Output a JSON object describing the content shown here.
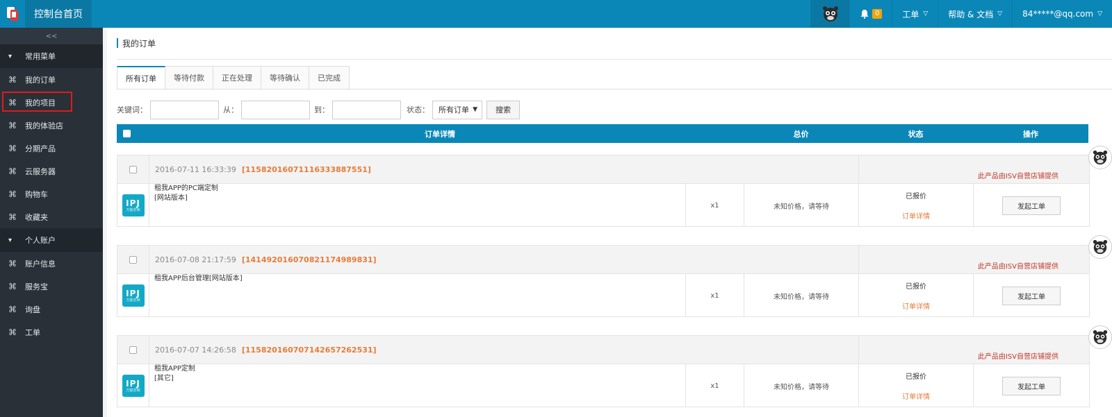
{
  "header": {
    "app_title": "控制台首页",
    "bell_count": "0",
    "menu_ticket": "工单",
    "menu_help": "帮助 & 文档",
    "user": "84*****@qq.com"
  },
  "sidebar": {
    "collapse_label": "<<",
    "group1": "常用菜单",
    "items1": [
      "我的订单",
      "我的项目",
      "我的体验店",
      "分期产品",
      "云服务器",
      "购物车",
      "收藏夹"
    ],
    "group2": "个人账户",
    "items2": [
      "账户信息",
      "服务宝",
      "询盘",
      "工单"
    ]
  },
  "main": {
    "page_title": "我的订单",
    "tabs": [
      "所有订单",
      "等待付款",
      "正在处理",
      "等待确认",
      "已完成"
    ],
    "filters": {
      "keyword_label": "关键词：",
      "from_label": "从：",
      "to_label": "到：",
      "status_label": "状态：",
      "status_value": "所有订单",
      "search_button": "搜索"
    },
    "table_headers": {
      "detail": "订单详情",
      "total": "总价",
      "status": "状态",
      "action": "操作"
    },
    "orders": [
      {
        "datetime": "2016-07-11 16:33:39",
        "order_no": "[11582016071116333887551]",
        "provider_note": "此产品由ISV自营店铺提供",
        "logo_text": "IPJ",
        "logo_sub": "万能定制",
        "name_line1": "租我APP的PC端定制",
        "name_line2": "[网站版本]",
        "qty": "x1",
        "price": "未知价格，请等待",
        "status": "已报价",
        "detail_link": "订单详情",
        "action_button": "发起工单"
      },
      {
        "datetime": "2016-07-08 21:17:59",
        "order_no": "[14149201607082117498983​1]",
        "provider_note": "此产品由ISV自营店铺提供",
        "logo_text": "IPJ",
        "logo_sub": "万能定制",
        "name_line1": "租我APP后台管理[网站版本]",
        "name_line2": "",
        "qty": "x1",
        "price": "未知价格，请等待",
        "status": "已报价",
        "detail_link": "订单详情",
        "action_button": "发起工单"
      },
      {
        "datetime": "2016-07-07 14:26:58",
        "order_no": "[11582016070714265726253​1]",
        "provider_note": "此产品由ISV自营店铺提供",
        "logo_text": "IPJ",
        "logo_sub": "万能定制",
        "name_line1": "租我APP定制",
        "name_line2": "[其它]",
        "qty": "x1",
        "price": "未知价格，请等待",
        "status": "已报价",
        "detail_link": "订单详情",
        "action_button": "发起工单"
      }
    ]
  },
  "colors": {
    "topbar": "#0a87b7",
    "sidebar": "#293038",
    "order_no": "#e67c39",
    "isv_note": "#c0392b",
    "highlight_box": "#e01b1b"
  }
}
